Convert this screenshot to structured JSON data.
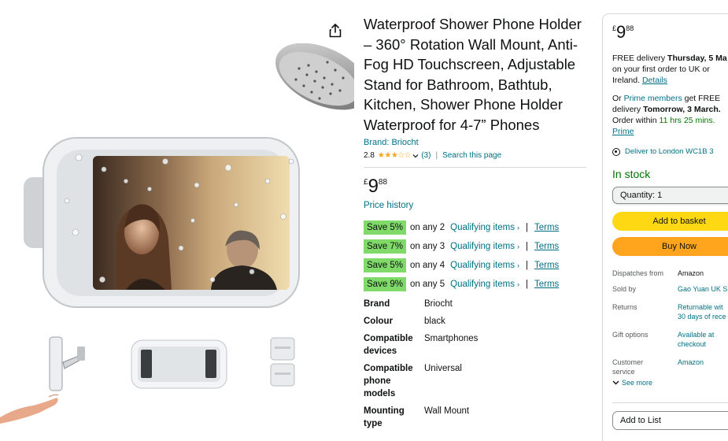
{
  "product": {
    "title": "Waterproof Shower Phone Holder – 360° Rotation Wall Mount, Anti-Fog HD Touchscreen, Adjustable Stand for Bathroom, Bathtub, Kitchen, Shower Phone Holder Waterproof for 4-7” Phones",
    "brand_link": "Brand: Briocht",
    "rating": "2.8",
    "rating_stars": 2.8,
    "review_count": "(3)",
    "search_page": "Search this page",
    "price": {
      "currency": "£",
      "whole": "9",
      "fraction": "88"
    },
    "price_history": "Price history",
    "promotions": [
      {
        "save": "Save 5%",
        "condition": "on any 2",
        "link": "Qualifying items",
        "terms": "Terms"
      },
      {
        "save": "Save 7%",
        "condition": "on any 3",
        "link": "Qualifying items",
        "terms": "Terms"
      },
      {
        "save": "Save 5%",
        "condition": "on any 4",
        "link": "Qualifying items",
        "terms": "Terms"
      },
      {
        "save": "Save 9%",
        "condition": "on any 5",
        "link": "Qualifying items",
        "terms": "Terms"
      }
    ],
    "specs": [
      {
        "key": "Brand",
        "value": "Briocht"
      },
      {
        "key": "Colour",
        "value": "black"
      },
      {
        "key": "Compatible devices",
        "value": "Smartphones"
      },
      {
        "key": "Compatible phone models",
        "value": "Universal"
      },
      {
        "key": "Mounting type",
        "value": "Wall Mount"
      }
    ]
  },
  "buybox": {
    "price": {
      "currency": "£",
      "whole": "9",
      "fraction": "88"
    },
    "delivery_prefix": "FREE delivery ",
    "delivery_date": "Thursday, 5 Ma",
    "delivery_line2": "on your first order to UK or",
    "delivery_line3_prefix": "Ireland. ",
    "details_link": "Details",
    "prime_prefix": "Or ",
    "prime_members": "Prime members",
    "prime_suffix": " get FREE",
    "prime_line2_prefix": "delivery ",
    "prime_date": "Tomorrow, 3 March.",
    "order_within_prefix": "Order within ",
    "order_within_time": "11 hrs 25 mins.",
    "prime_link": "Prime",
    "deliver_to": "Deliver to London WC1B 3",
    "stock": "In stock",
    "quantity": "Quantity: 1",
    "add_to_basket": "Add to basket",
    "buy_now": "Buy Now",
    "info": [
      {
        "key": "Dispatches from",
        "value": "Amazon",
        "link": false
      },
      {
        "key": "Sold by",
        "value": "Gao Yuan UK S",
        "link": true
      },
      {
        "key": "Returns",
        "value": "Returnable wit\n30 days of rece",
        "link": true
      },
      {
        "key": "Gift options",
        "value": "Available at\ncheckout",
        "link": true
      },
      {
        "key": "Customer\nservice",
        "value": "Amazon",
        "link": true
      }
    ],
    "see_more": "See more",
    "add_to_list": "Add to List"
  },
  "icons": {
    "share": "share-icon",
    "pin": "location-pin-icon",
    "chevron": "chevron-down-icon"
  },
  "colors": {
    "link": "#007185",
    "save_badge": "#7FDA69",
    "basket_button": "#FFD814",
    "buy_button": "#FFA41C",
    "in_stock": "#007600",
    "star": "#FFA41C"
  }
}
